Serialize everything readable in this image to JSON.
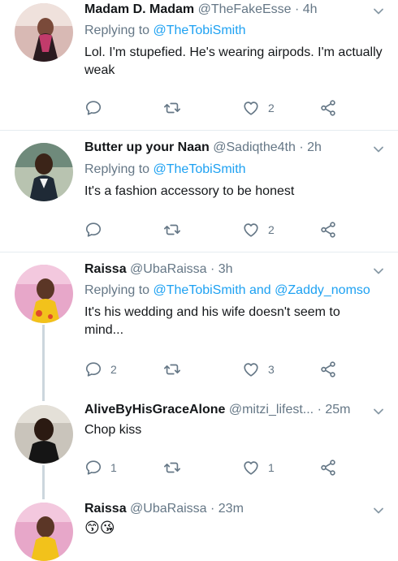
{
  "tweets": [
    {
      "name": "Madam D. Madam",
      "handle": "@TheFakeEsse",
      "sep": "·",
      "time": "4h",
      "replying_prefix": "Replying to ",
      "replying_to": "@TheTobiSmith",
      "replying_and": "",
      "replying_to2": "",
      "text": "Lol. I'm stupefied. He's wearing airpods. I'm actually weak",
      "reply_count": "",
      "retweet_count": "",
      "like_count": "2"
    },
    {
      "name": "Butter up your Naan",
      "handle": "@Sadiqthe4th",
      "sep": "·",
      "time": "2h",
      "replying_prefix": "Replying to ",
      "replying_to": "@TheTobiSmith",
      "replying_and": "",
      "replying_to2": "",
      "text": "It's a fashion accessory to be honest",
      "reply_count": "",
      "retweet_count": "",
      "like_count": "2"
    },
    {
      "name": "Raissa",
      "handle": "@UbaRaissa",
      "sep": "·",
      "time": "3h",
      "replying_prefix": "Replying to ",
      "replying_to": "@TheTobiSmith",
      "replying_and": " and ",
      "replying_to2": "@Zaddy_nomso",
      "text": "It's his wedding and his wife doesn't seem to mind...",
      "reply_count": "2",
      "retweet_count": "",
      "like_count": "3"
    },
    {
      "name": "AliveByHisGraceAlone",
      "handle": "@mitzi_lifest...",
      "sep": "·",
      "time": "25m",
      "text": "Chop kiss",
      "reply_count": "1",
      "retweet_count": "",
      "like_count": "1"
    },
    {
      "name": "Raissa",
      "handle": "@UbaRaissa",
      "sep": "·",
      "time": "23m",
      "text": "😙😘"
    }
  ],
  "colors": {
    "link": "#1da1f2",
    "muted": "#657786",
    "text": "#14171a",
    "thread_line": "#ccd6dd"
  },
  "icons": [
    "reply-icon",
    "retweet-icon",
    "like-icon",
    "share-icon",
    "chevron-down-icon"
  ]
}
